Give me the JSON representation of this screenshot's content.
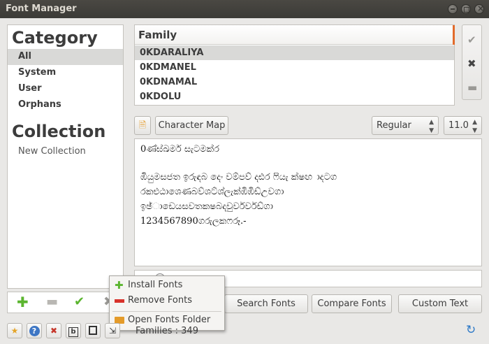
{
  "window": {
    "title": "Font Manager"
  },
  "sidebar": {
    "category_heading": "Category",
    "categories": [
      {
        "label": "All",
        "selected": true
      },
      {
        "label": "System",
        "selected": false
      },
      {
        "label": "User",
        "selected": false
      },
      {
        "label": "Orphans",
        "selected": false
      }
    ],
    "collection_heading": "Collection",
    "collections": [
      {
        "label": "New Collection"
      }
    ]
  },
  "family_list": {
    "header": "Family",
    "rows": [
      {
        "label": "0KDARALIYA",
        "selected": true
      },
      {
        "label": "0KDMANEL",
        "selected": false
      },
      {
        "label": "0KDNAMAL",
        "selected": false
      },
      {
        "label": "0KDOLU",
        "selected": false
      }
    ]
  },
  "preview_toolbar": {
    "character_map": "Character Map",
    "style_value": "Regular",
    "size_value": "11.0"
  },
  "preview": {
    "lines": [
      "0ණ්ඝ්ඛමර් සැටමක්ර",
      "ඹියුමසජත ඉරුඳබ දෙං වම්පව් දඪර ෆියැ ක්ෂඟ ාදටග",
      "රකළුඨාශෙණබව්ශට්ශ්ලැක්ඹිඹිඩ්උවගා",
      "ඉඡ්ාඩෙයසවතකෂබදවුර්වර්වඩ්ගා",
      "1234567890ගරුලකෆරූ.-"
    ]
  },
  "popup_menu": {
    "items": [
      {
        "label": "Install Fonts",
        "icon": "plus-icon"
      },
      {
        "label": "Remove Fonts",
        "icon": "minus-icon"
      },
      {
        "label": "Open Fonts Folder",
        "icon": "folder-icon"
      }
    ]
  },
  "action_buttons": {
    "search": "Search Fonts",
    "compare": "Compare Fonts",
    "custom": "Custom Text"
  },
  "status": {
    "families": "Families : 349"
  },
  "colors": {
    "accent": "#e26b2b",
    "plus": "#5bb52f",
    "remove": "#d8322b",
    "folder": "#e49b2a",
    "refresh": "#2d79c7"
  }
}
